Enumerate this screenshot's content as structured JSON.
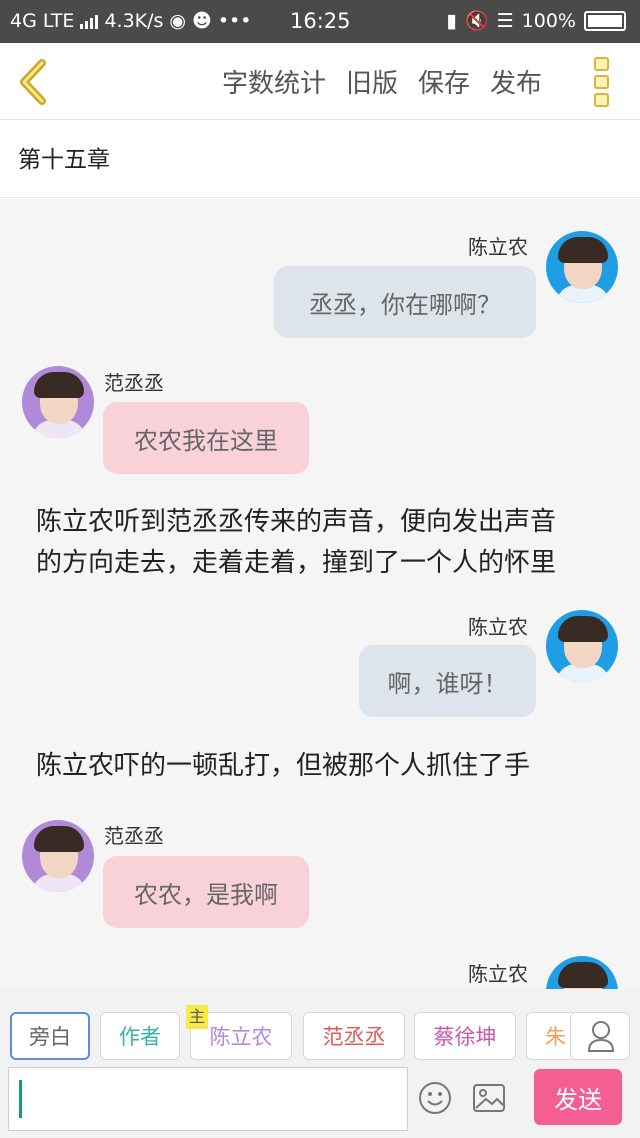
{
  "status_bar": {
    "network": "4G LTE",
    "speed": "4.3K/s",
    "more": "•••",
    "time": "16:25",
    "battery": "100%"
  },
  "toolbar": {
    "actions": [
      "字数统计",
      "旧版",
      "保存",
      "发布"
    ]
  },
  "chapter": {
    "title": "第十五章"
  },
  "messages": [
    {
      "speaker": "陈立农",
      "text": "丞丞，你在哪啊？"
    },
    {
      "speaker": "范丞丞",
      "text": "农农我在这里"
    },
    {
      "narration_lines": [
        "陈立农听到范丞丞传来的声音，便向发出声音",
        "的方向走去，走着走着，撞到了一个人的怀里"
      ]
    },
    {
      "speaker": "陈立农",
      "text": "啊，谁呀！"
    },
    {
      "narration_lines": [
        "陈立农吓的一顿乱打，但被那个人抓住了手"
      ]
    },
    {
      "speaker": "范丞丞",
      "text": "农农，是我啊"
    },
    {
      "speaker": "陈立农",
      "text": ""
    }
  ],
  "roles": {
    "main_tag": "主",
    "chips": [
      "旁白",
      "作者",
      "陈立农",
      "范丞丞",
      "蔡徐坤",
      "朱"
    ]
  },
  "input": {
    "send_label": "发送",
    "value": ""
  },
  "colors": {
    "accent": "#f45f93",
    "right_bubble": "#dde4ec",
    "left_bubble": "#f9d1d9",
    "menu_icon": "#d7b43a"
  }
}
